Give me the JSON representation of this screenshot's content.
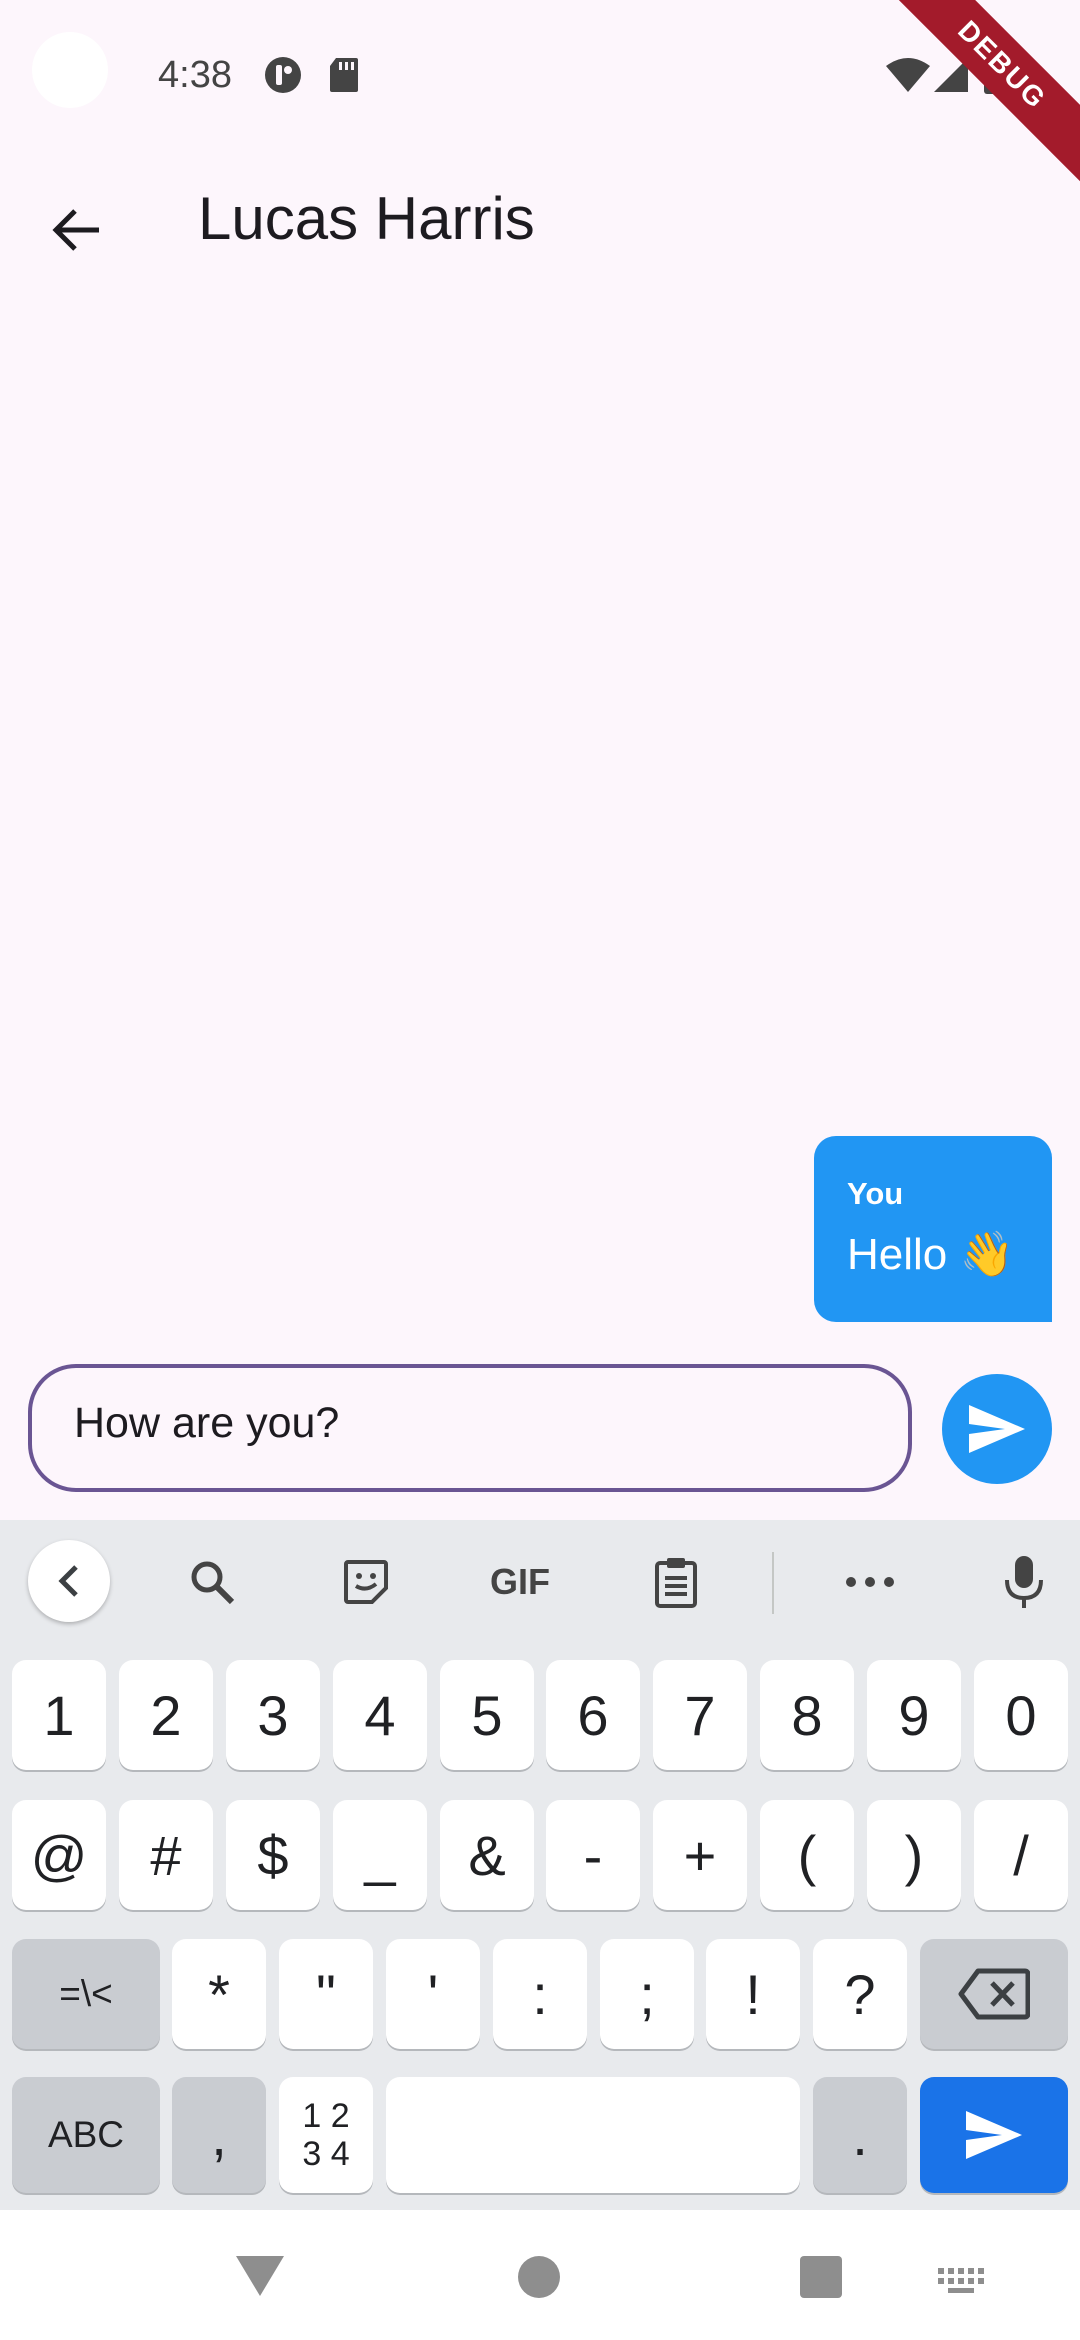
{
  "status_bar": {
    "time": "4:38"
  },
  "debug_ribbon": "DEBUG",
  "app_bar": {
    "title": "Lucas Harris"
  },
  "messages": [
    {
      "sender": "You",
      "text": "Hello 👋"
    }
  ],
  "composer": {
    "value": "How are you?"
  },
  "keyboard": {
    "toolbar": [
      "back-icon",
      "search-icon",
      "sticker-icon",
      "GIF",
      "clipboard-icon",
      "more-icon",
      "mic-icon"
    ],
    "row1": [
      "1",
      "2",
      "3",
      "4",
      "5",
      "6",
      "7",
      "8",
      "9",
      "0"
    ],
    "row2": [
      "@",
      "#",
      "$",
      "_",
      "&",
      "-",
      "+",
      "(",
      ")",
      "/"
    ],
    "row3": [
      "=\\<",
      "*",
      "\"",
      "'",
      ":",
      ";",
      "!",
      "?"
    ],
    "row4": {
      "abc": "ABC",
      "comma": ",",
      "numpad_top": "1 2",
      "numpad_bottom": "3 4",
      "period": "."
    }
  },
  "colors": {
    "accent": "#2196F3",
    "outline": "#6A5593",
    "keyboard_enter": "#1A73E8",
    "background": "#FDF6FC"
  }
}
